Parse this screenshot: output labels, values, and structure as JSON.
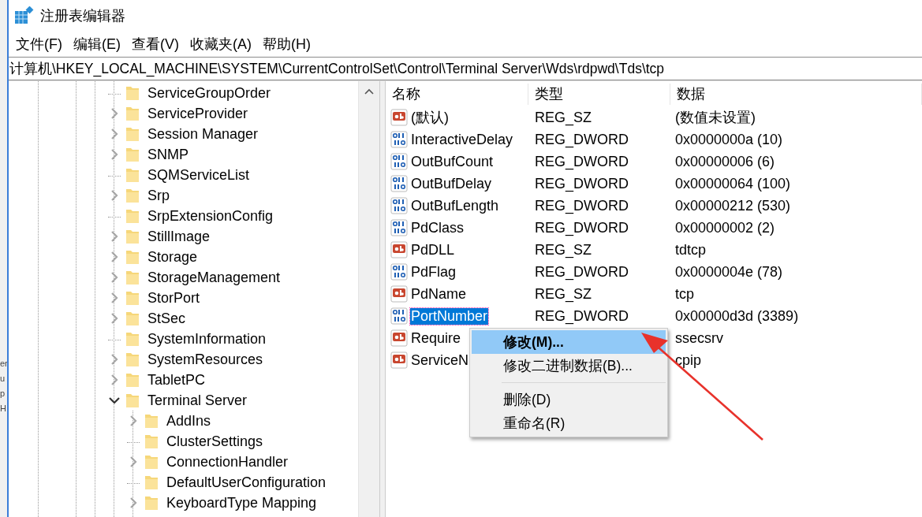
{
  "background_window": {
    "fragments": [
      "er",
      "u",
      "p",
      "H"
    ]
  },
  "window": {
    "title": "注册表编辑器"
  },
  "menu_bar": [
    "文件(F)",
    "编辑(E)",
    "查看(V)",
    "收藏夹(A)",
    "帮助(H)"
  ],
  "address_bar": {
    "value": "计算机\\HKEY_LOCAL_MACHINE\\SYSTEM\\CurrentControlSet\\Control\\Terminal Server\\Wds\\rdpwd\\Tds\\tcp"
  },
  "tree": [
    {
      "label": "ServiceGroupOrder",
      "expandable": false,
      "expanded": false
    },
    {
      "label": "ServiceProvider",
      "expandable": true,
      "expanded": false
    },
    {
      "label": "Session Manager",
      "expandable": true,
      "expanded": false
    },
    {
      "label": "SNMP",
      "expandable": true,
      "expanded": false
    },
    {
      "label": "SQMServiceList",
      "expandable": false,
      "expanded": false
    },
    {
      "label": "Srp",
      "expandable": true,
      "expanded": false
    },
    {
      "label": "SrpExtensionConfig",
      "expandable": false,
      "expanded": false
    },
    {
      "label": "StillImage",
      "expandable": true,
      "expanded": false
    },
    {
      "label": "Storage",
      "expandable": true,
      "expanded": false
    },
    {
      "label": "StorageManagement",
      "expandable": true,
      "expanded": false
    },
    {
      "label": "StorPort",
      "expandable": true,
      "expanded": false
    },
    {
      "label": "StSec",
      "expandable": true,
      "expanded": false
    },
    {
      "label": "SystemInformation",
      "expandable": false,
      "expanded": false
    },
    {
      "label": "SystemResources",
      "expandable": true,
      "expanded": false
    },
    {
      "label": "TabletPC",
      "expandable": true,
      "expanded": false
    },
    {
      "label": "Terminal Server",
      "expandable": true,
      "expanded": true,
      "children": [
        {
          "label": "AddIns",
          "expandable": true,
          "expanded": false
        },
        {
          "label": "ClusterSettings",
          "expandable": false,
          "expanded": false
        },
        {
          "label": "ConnectionHandler",
          "expandable": true,
          "expanded": false
        },
        {
          "label": "DefaultUserConfiguration",
          "expandable": false,
          "expanded": false
        },
        {
          "label": "KeyboardType Mapping",
          "expandable": true,
          "expanded": false
        }
      ]
    }
  ],
  "values": {
    "columns": [
      "名称",
      "类型",
      "数据"
    ],
    "rows": [
      {
        "kind": "string",
        "name": "(默认)",
        "type": "REG_SZ",
        "data": "(数值未设置)",
        "selected": false
      },
      {
        "kind": "dword",
        "name": "InteractiveDelay",
        "type": "REG_DWORD",
        "data": "0x0000000a (10)",
        "selected": false
      },
      {
        "kind": "dword",
        "name": "OutBufCount",
        "type": "REG_DWORD",
        "data": "0x00000006 (6)",
        "selected": false
      },
      {
        "kind": "dword",
        "name": "OutBufDelay",
        "type": "REG_DWORD",
        "data": "0x00000064 (100)",
        "selected": false
      },
      {
        "kind": "dword",
        "name": "OutBufLength",
        "type": "REG_DWORD",
        "data": "0x00000212 (530)",
        "selected": false
      },
      {
        "kind": "dword",
        "name": "PdClass",
        "type": "REG_DWORD",
        "data": "0x00000002 (2)",
        "selected": false
      },
      {
        "kind": "string",
        "name": "PdDLL",
        "type": "REG_SZ",
        "data": "tdtcp",
        "selected": false
      },
      {
        "kind": "dword",
        "name": "PdFlag",
        "type": "REG_DWORD",
        "data": "0x0000004e (78)",
        "selected": false
      },
      {
        "kind": "string",
        "name": "PdName",
        "type": "REG_SZ",
        "data": "tcp",
        "selected": false
      },
      {
        "kind": "dword",
        "name": "PortNumber",
        "type": "REG_DWORD",
        "data": "0x00000d3d (3389)",
        "selected": true
      },
      {
        "kind": "string",
        "name": "Require",
        "data": "ssecsrv",
        "selected": false
      },
      {
        "kind": "string",
        "name": "ServiceN",
        "data": "cpip",
        "selected": false
      }
    ]
  },
  "context_menu": {
    "items": [
      {
        "kind": "item",
        "label": "修改(M)...",
        "default": true,
        "selected": true
      },
      {
        "kind": "item",
        "label": "修改二进制数据(B)...",
        "default": false,
        "selected": false
      },
      {
        "kind": "separator"
      },
      {
        "kind": "item",
        "label": "删除(D)",
        "default": false,
        "selected": false
      },
      {
        "kind": "item",
        "label": "重命名(R)",
        "default": false,
        "selected": false
      }
    ]
  }
}
